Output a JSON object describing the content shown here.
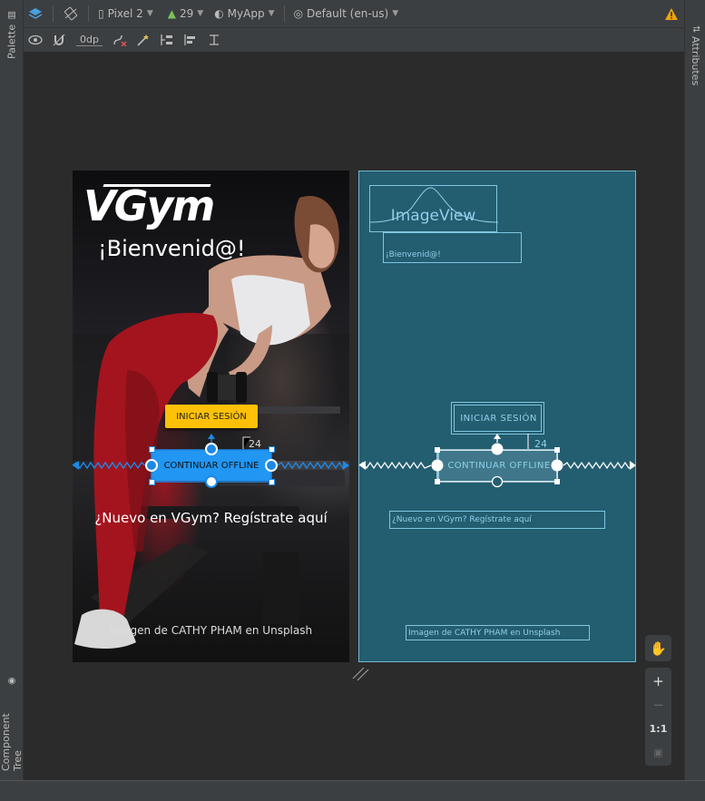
{
  "toolbar": {
    "device": "Pixel 2",
    "api_level": "29",
    "theme": "MyApp",
    "locale": "Default (en-us)",
    "default_margin": "0dp"
  },
  "side_tabs": {
    "palette": "Palette",
    "attributes": "Attributes",
    "component_tree": "Component Tree"
  },
  "design": {
    "logo": "VGym",
    "welcome": "¡Bienvenid@!",
    "login_button": "INICIAR SESIÓN",
    "offline_button": "CONTINUAR OFFLINE",
    "signup_text": "¿Nuevo en VGym? Regístrate aquí",
    "photo_credit": "Imagen de CATHY PHAM en Unsplash",
    "margin_value": "24"
  },
  "blueprint": {
    "imageview": "ImageView",
    "welcome": "¡Bienvenid@!",
    "login_button": "INICIAR SESIÓN",
    "offline_button": "CONTINUAR OFFLINE",
    "signup_text": "¿Nuevo en VGym? Regístrate aquí",
    "photo_credit": "Imagen de CATHY PHAM en Unsplash",
    "margin_value": "24"
  },
  "zoom": {
    "plus": "+",
    "minus": "−",
    "one_to_one": "1:1"
  },
  "colors": {
    "accent": "#2196f3",
    "login_button": "#ffc107",
    "blueprint_bg": "#235d70",
    "warning": "#f0a30a"
  }
}
